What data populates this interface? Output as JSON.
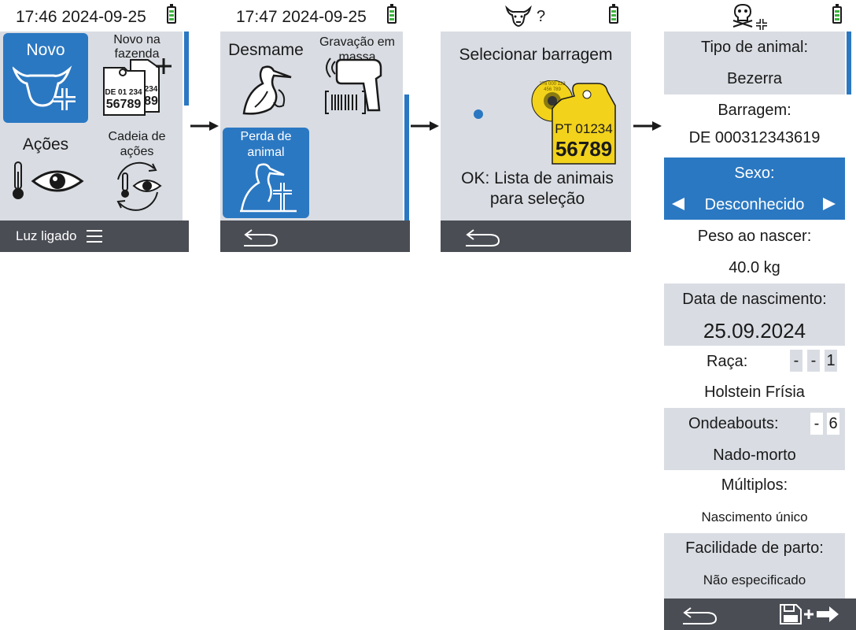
{
  "screen1": {
    "time": "17:46 2024-09-25",
    "tiles": {
      "novo": "Novo",
      "novo_fazenda": "Novo na fazenda",
      "acoes": "Ações",
      "cadeia": "Cadeia de ações"
    },
    "tag_line1": "DE 01 234",
    "tag_line2": "56789",
    "tag_back1": "234",
    "tag_back2": "89",
    "footer": "Luz ligado"
  },
  "screen2": {
    "time": "17:47 2024-09-25",
    "tiles": {
      "desmame": "Desmame",
      "gravacao": "Gravação em massa",
      "perda": "Perda de animal"
    }
  },
  "screen3": {
    "title": "Selecionar barragem",
    "tag_round": "276 000 123 456 789",
    "tag_line1": "PT 01234",
    "tag_line2": "56789",
    "ok_text": "OK: Lista de animais para seleção",
    "status_symbol": "?"
  },
  "screen4": {
    "tipo_label": "Tipo de animal:",
    "tipo_value": "Bezerra",
    "barragem_label": "Barragem:",
    "barragem_value": "DE 000312343619",
    "sexo_label": "Sexo:",
    "sexo_value": "Desconhecido",
    "peso_label": "Peso ao nascer:",
    "peso_value": "40.0 kg",
    "data_label": "Data de nascimento:",
    "data_value": "25.09.2024",
    "raca_label": "Raça:",
    "raca_codes": [
      "-",
      "-",
      "1"
    ],
    "raca_value": "Holstein Frísia",
    "onde_label": "Ondeabouts:",
    "onde_codes": [
      "-",
      "6"
    ],
    "onde_value": "Nado-morto",
    "multiplos_label": "Múltiplos:",
    "multiplos_value": "Nascimento único",
    "facilidade_label": "Facilidade de parto:",
    "facilidade_value": "Não especificado"
  },
  "colors": {
    "accent": "#2b78c2",
    "panel": "#d9dde3",
    "footer": "#4a4d54",
    "tag_yellow": "#f2d21b",
    "battery": "#3db33d"
  }
}
